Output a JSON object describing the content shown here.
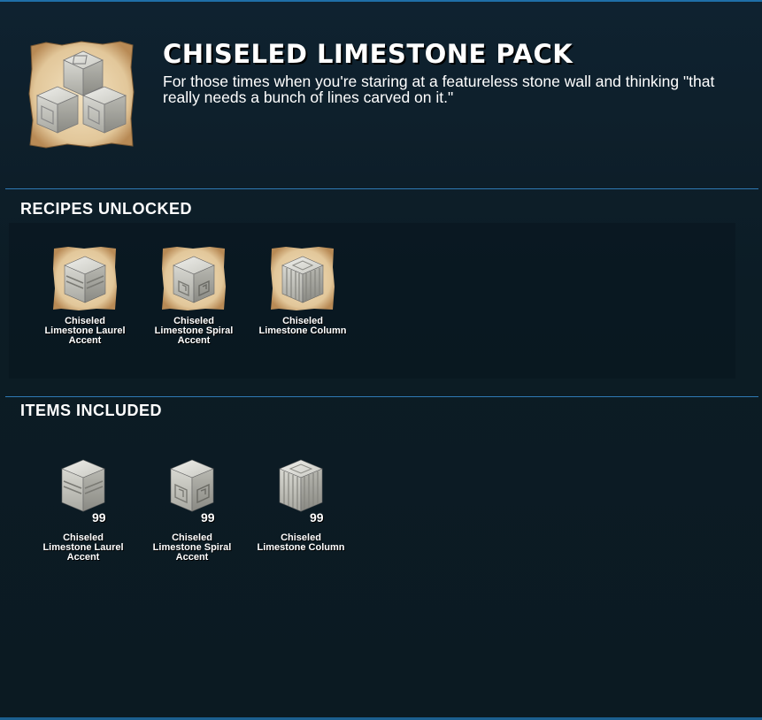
{
  "pack": {
    "title": "CHISELED LIMESTONE PACK",
    "description": "For those times when you're staring at a featureless stone wall and thinking \"that really needs a bunch of lines carved on it.\"",
    "icon": "limestone-blocks-icon"
  },
  "recipes": {
    "heading": "RECIPES UNLOCKED",
    "items": [
      {
        "label": "Chiseled Limestone Laurel Accent",
        "icon": "laurel-accent-block-icon"
      },
      {
        "label": "Chiseled Limestone Spiral Accent",
        "icon": "spiral-accent-block-icon"
      },
      {
        "label": "Chiseled Limestone Column",
        "icon": "column-block-icon"
      }
    ]
  },
  "included": {
    "heading": "ITEMS INCLUDED",
    "items": [
      {
        "label": "Chiseled Limestone Laurel Accent",
        "quantity": "99",
        "icon": "laurel-accent-block-icon"
      },
      {
        "label": "Chiseled Limestone Spiral Accent",
        "quantity": "99",
        "icon": "spiral-accent-block-icon"
      },
      {
        "label": "Chiseled Limestone Column",
        "quantity": "99",
        "icon": "column-block-icon"
      }
    ]
  },
  "colors": {
    "background": "#0c1c25",
    "divider": "#2f7ab5",
    "parchment": "#e8d2a8",
    "stone": "#cfcfc8"
  }
}
